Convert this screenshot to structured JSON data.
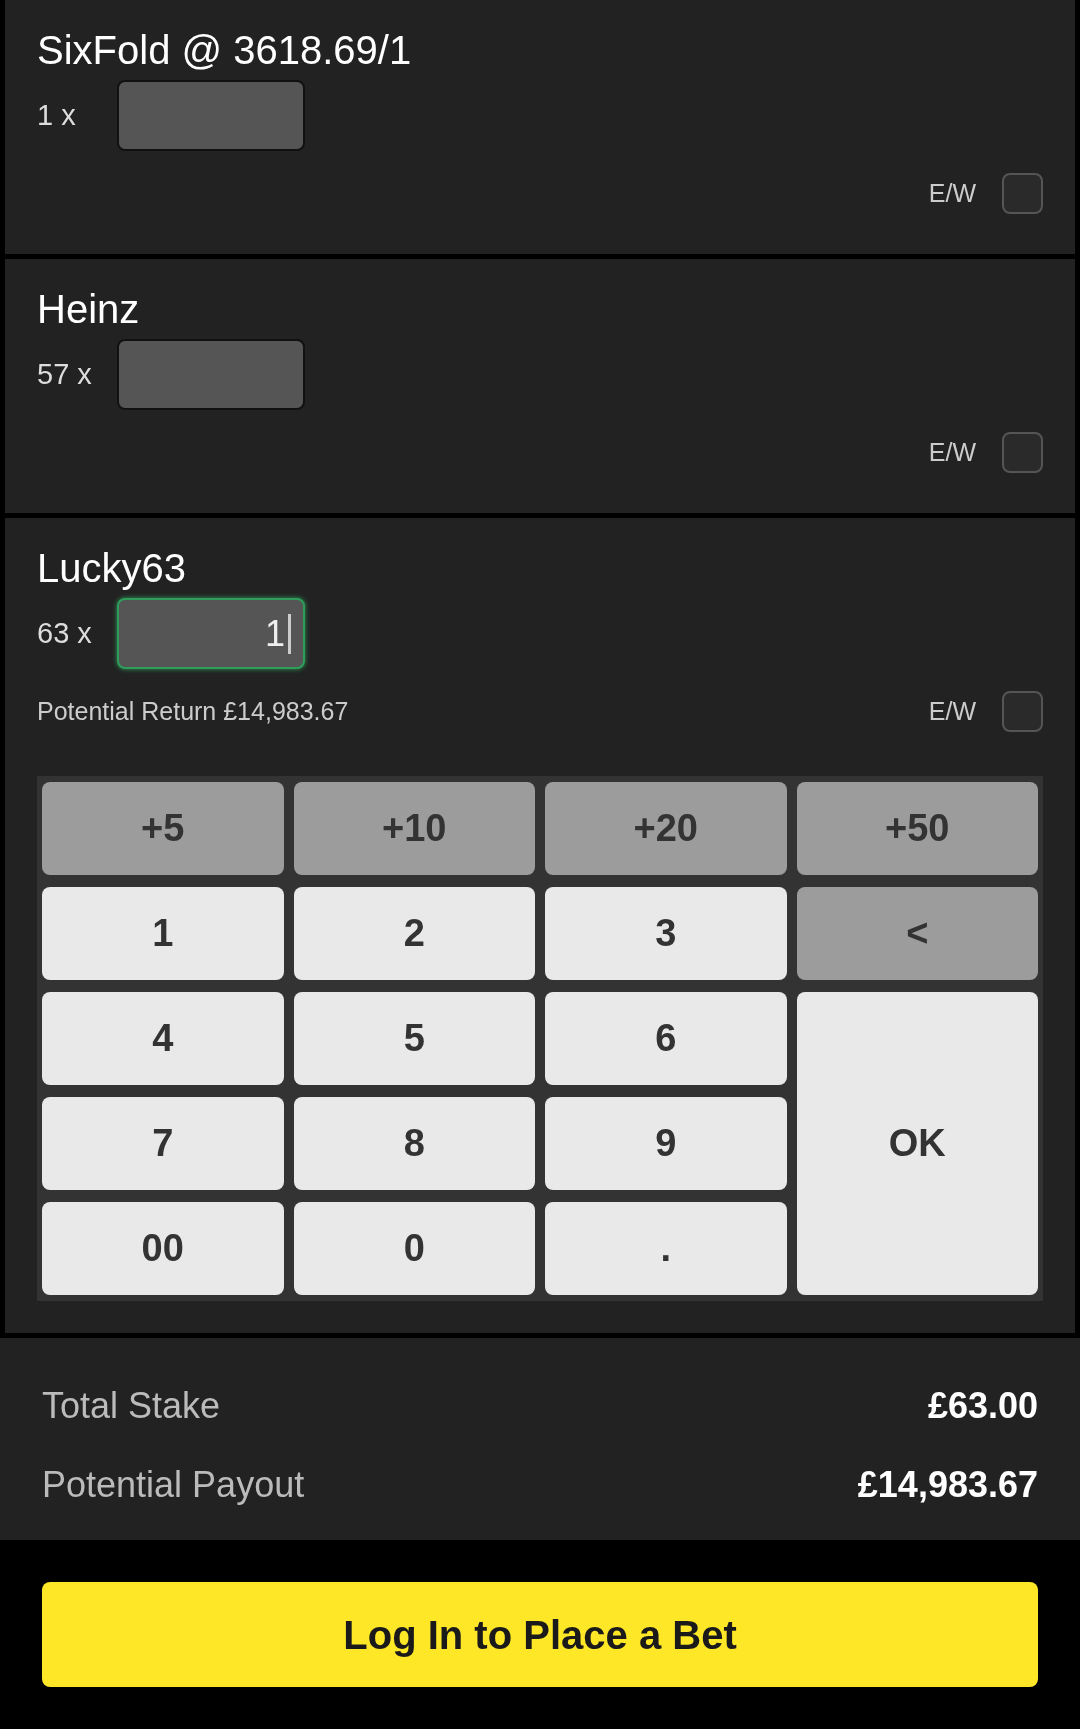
{
  "bets": [
    {
      "title": "SixFold @ 3618.69/1",
      "multiplier": "1 x",
      "stake": {
        "focused": false
      },
      "ew_label": "E/W",
      "ew_checked": false
    },
    {
      "title": "Heinz",
      "multiplier": "57 x",
      "stake": {
        "focused": false
      },
      "ew_label": "E/W",
      "ew_checked": false
    },
    {
      "title": "Lucky63",
      "multiplier": "63 x",
      "stake": {
        "value": "1",
        "focused": true
      },
      "potential_return": "Potential Return £14,983.67",
      "ew_label": "E/W",
      "ew_checked": false,
      "keypad": [
        {
          "label": "+5",
          "kind": "quick"
        },
        {
          "label": "+10",
          "kind": "quick"
        },
        {
          "label": "+20",
          "kind": "quick"
        },
        {
          "label": "+50",
          "kind": "quick"
        },
        {
          "label": "1",
          "kind": "digit"
        },
        {
          "label": "2",
          "kind": "digit"
        },
        {
          "label": "3",
          "kind": "digit"
        },
        {
          "label": "<",
          "kind": "backspace"
        },
        {
          "label": "4",
          "kind": "digit"
        },
        {
          "label": "5",
          "kind": "digit"
        },
        {
          "label": "6",
          "kind": "digit"
        },
        {
          "label": "7",
          "kind": "digit"
        },
        {
          "label": "8",
          "kind": "digit"
        },
        {
          "label": "9",
          "kind": "digit"
        },
        {
          "label": "OK",
          "kind": "ok"
        },
        {
          "label": "00",
          "kind": "digit"
        },
        {
          "label": "0",
          "kind": "digit"
        },
        {
          "label": ".",
          "kind": "digit"
        }
      ]
    }
  ],
  "summary": [
    {
      "label": "Total Stake",
      "value": "£63.00"
    },
    {
      "label": "Potential Payout",
      "value": "£14,983.67"
    }
  ],
  "login_button": "Log In to Place a Bet"
}
